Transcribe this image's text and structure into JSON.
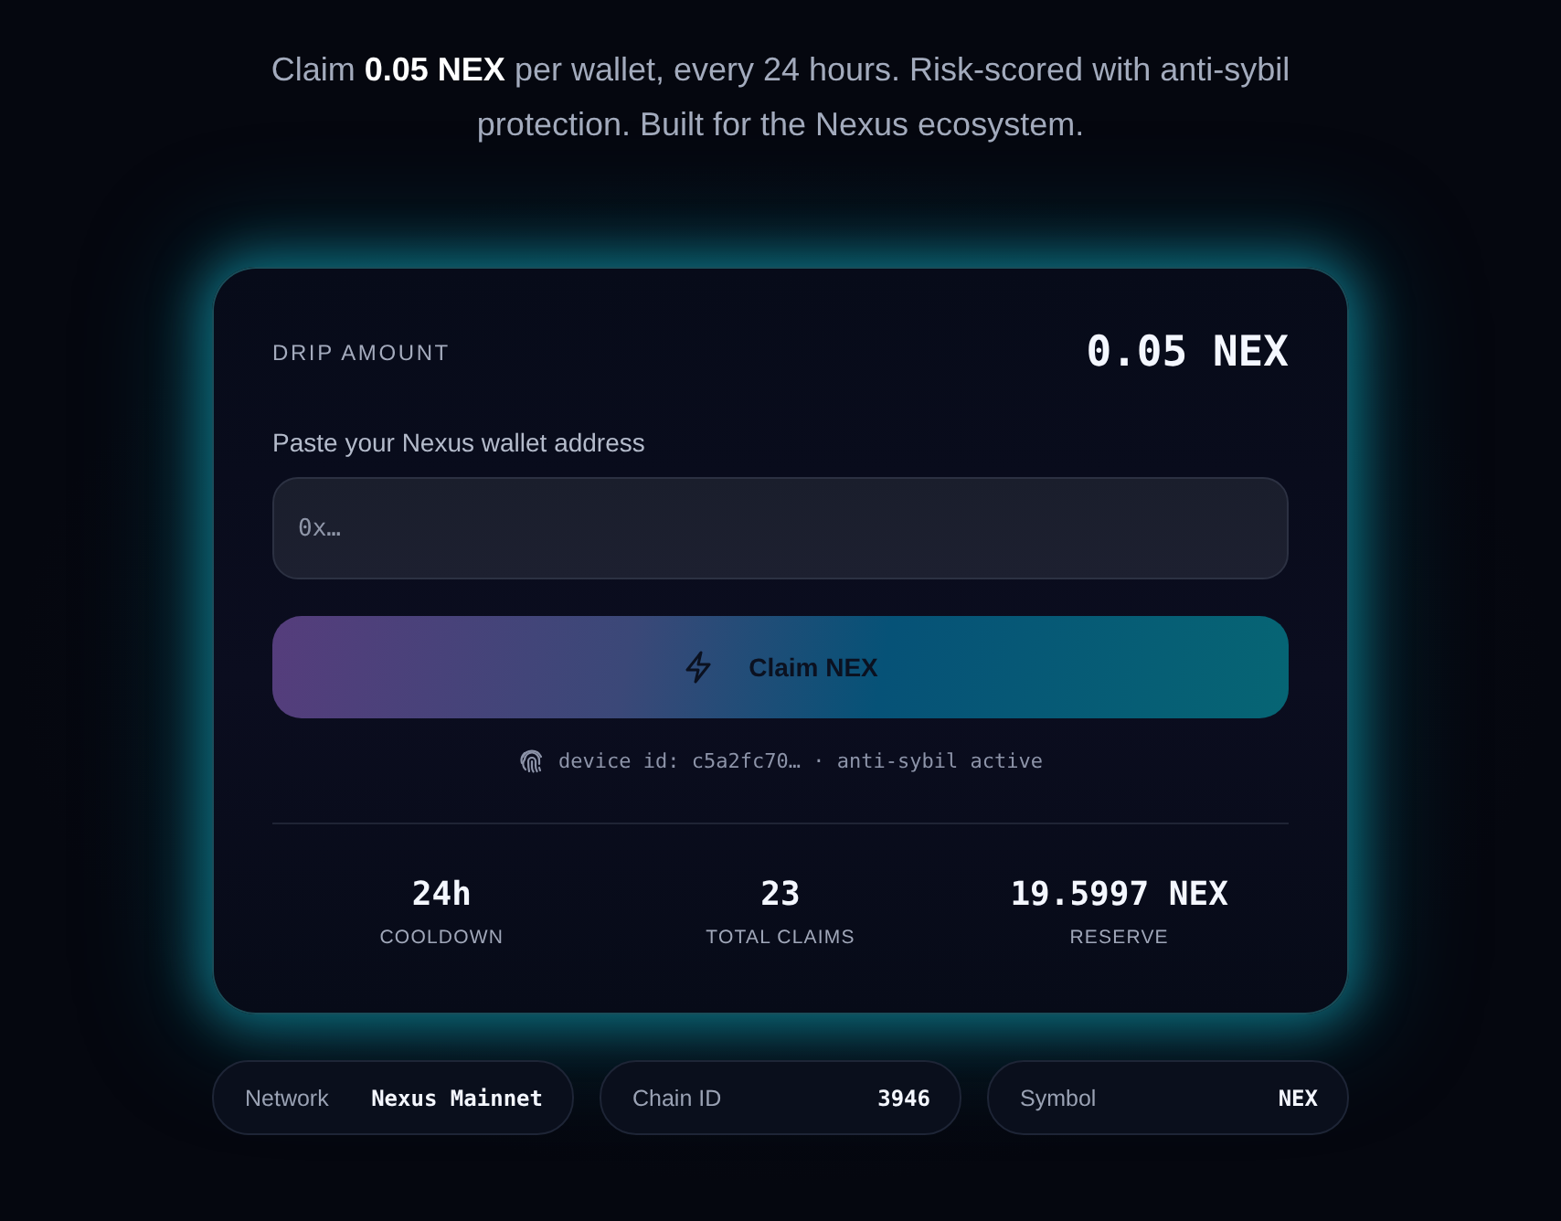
{
  "intro": "Claim **0.05 NEX** per wallet, every 24 hours. Risk-scored with anti-sybil protection. Built for the Nexus ecosystem.",
  "card": {
    "drip_label": "DRIP AMOUNT",
    "drip_value": "0.05 NEX",
    "address_label": "Paste your Nexus wallet address",
    "address_field": {
      "placeholder": "0x…"
    },
    "claim_button": "Claim NEX",
    "device_note": "device id: c5a2fc70… · anti-sybil active",
    "stats": [
      {
        "value": "24h",
        "label": "COOLDOWN"
      },
      {
        "value": "23",
        "label": "TOTAL CLAIMS"
      },
      {
        "value": "19.5997 NEX",
        "label": "RESERVE"
      }
    ]
  },
  "info_pills": [
    {
      "label": "Network",
      "value": "Nexus Mainnet"
    },
    {
      "label": "Chain ID",
      "value": "3946"
    },
    {
      "label": "Symbol",
      "value": "NEX"
    }
  ]
}
